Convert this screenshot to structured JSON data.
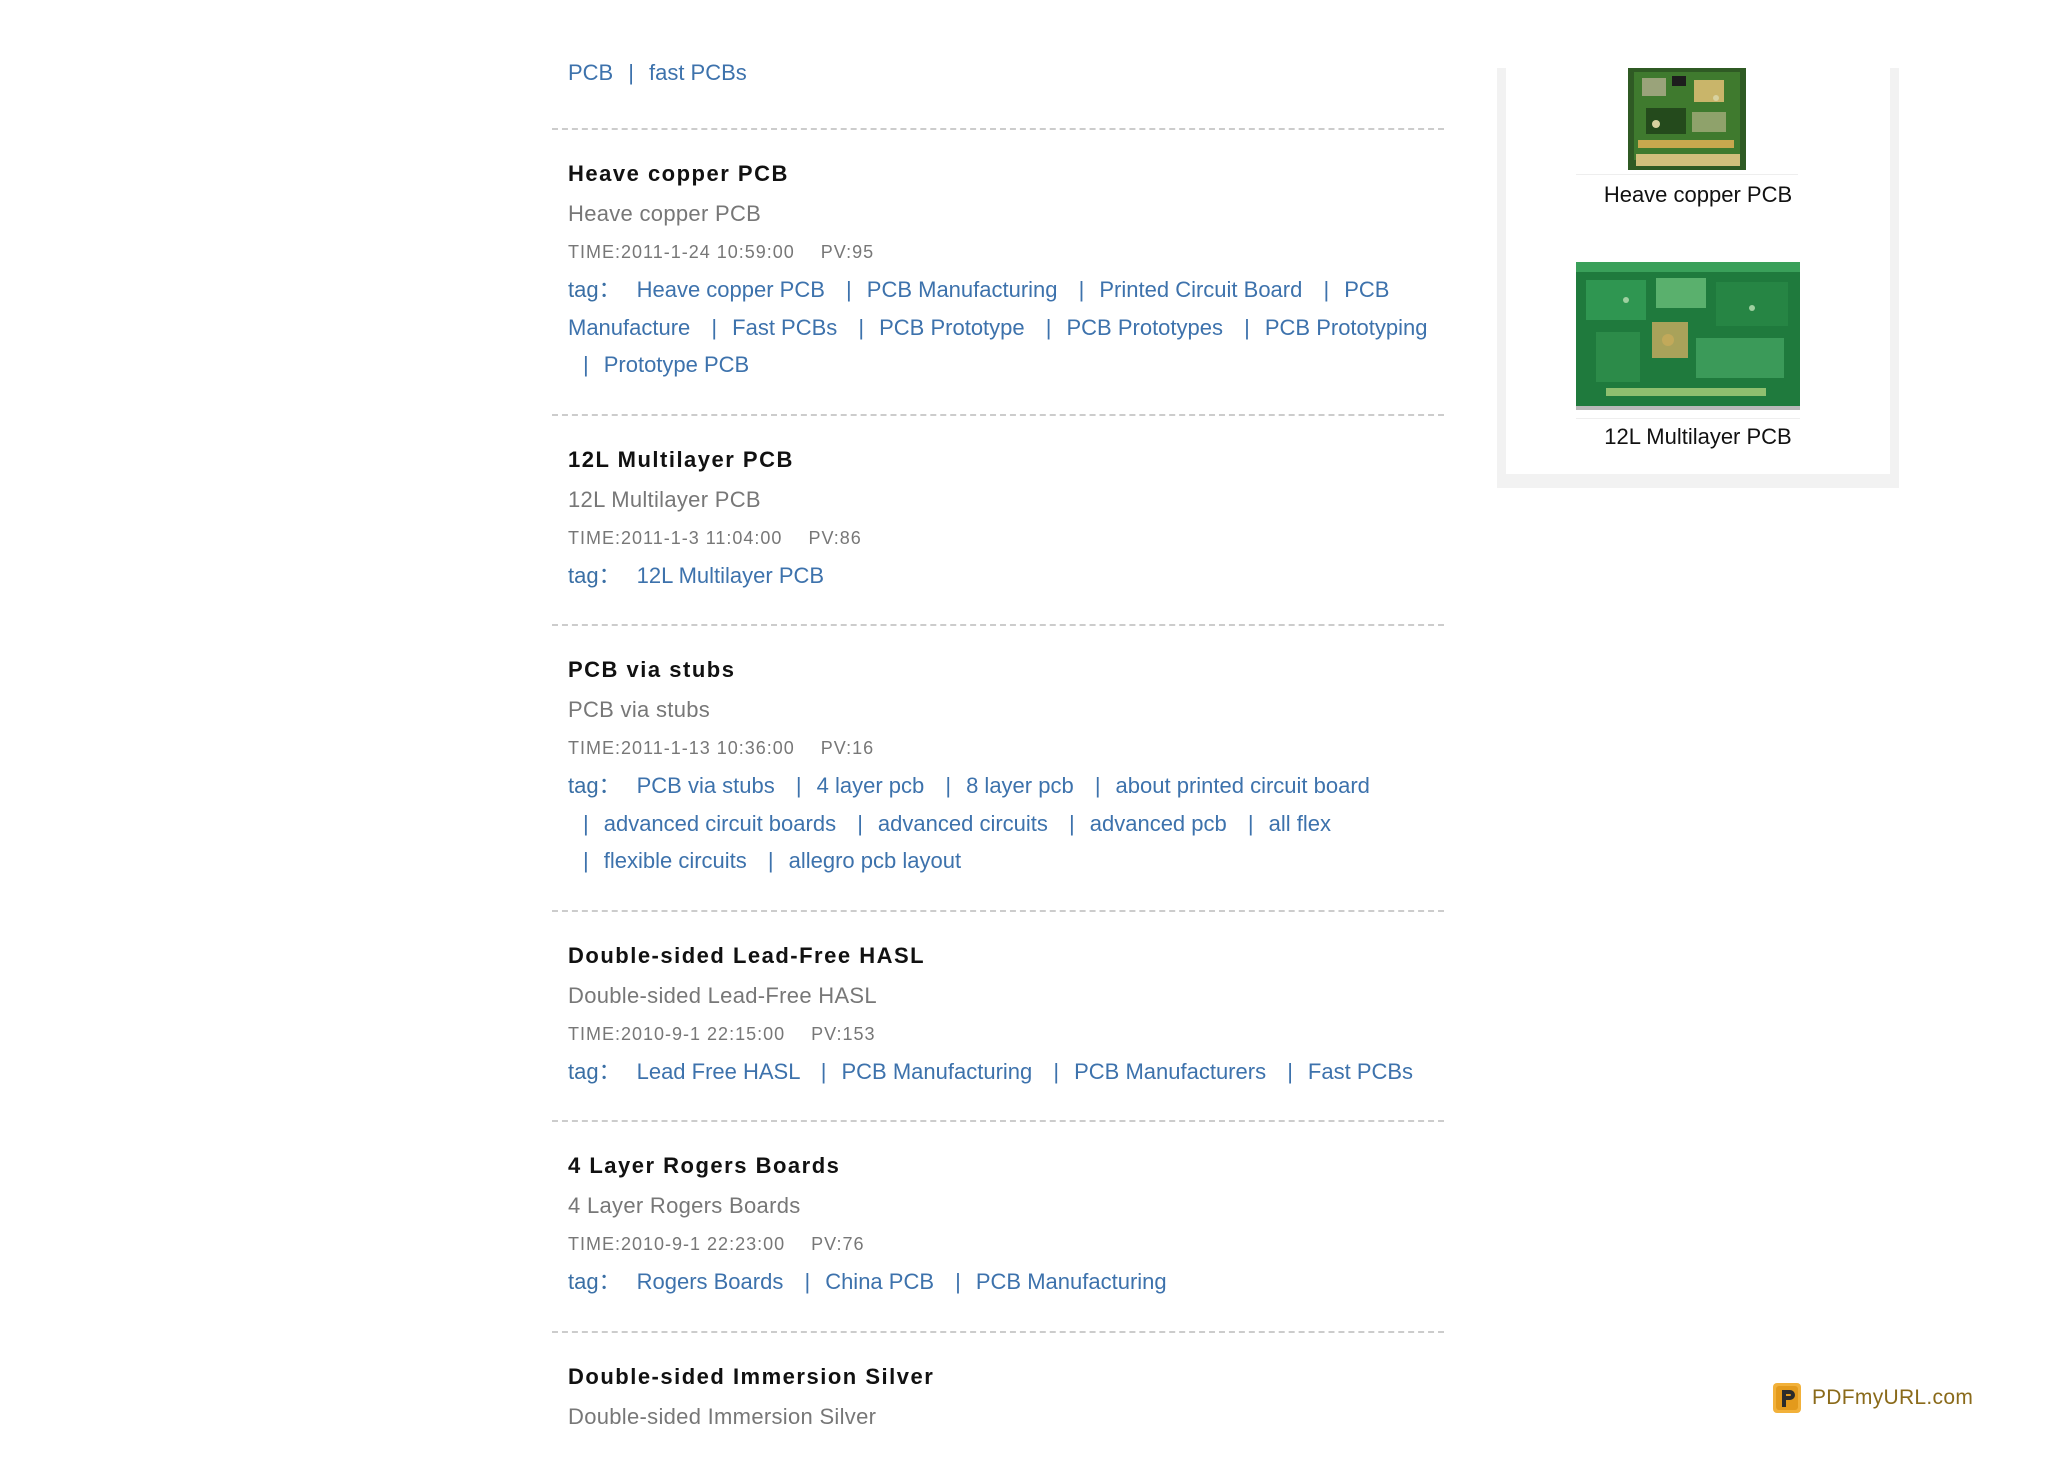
{
  "top_tags": [
    "PCB",
    "fast PCBs"
  ],
  "tag_label": "tag：",
  "articles": [
    {
      "title": "Heave copper PCB",
      "summary": "Heave copper PCB",
      "time": "TIME:2011-1-24 10:59:00",
      "pv": "PV:95",
      "tags": [
        "Heave copper PCB",
        "PCB Manufacturing",
        "Printed Circuit Board",
        "PCB Manufacture",
        "Fast PCBs",
        "PCB Prototype",
        "PCB Prototypes",
        "PCB Prototyping",
        "Prototype PCB"
      ]
    },
    {
      "title": "12L Multilayer PCB",
      "summary": "12L Multilayer PCB",
      "time": "TIME:2011-1-3 11:04:00",
      "pv": "PV:86",
      "tags": [
        "12L Multilayer PCB"
      ]
    },
    {
      "title": "PCB via stubs",
      "summary": "PCB via stubs",
      "time": "TIME:2011-1-13 10:36:00",
      "pv": "PV:16",
      "tags": [
        "PCB via stubs",
        "4 layer pcb",
        "8 layer pcb",
        "about printed circuit board",
        "advanced circuit boards",
        "advanced circuits",
        "advanced pcb",
        "all flex",
        "flexible circuits",
        "allegro pcb layout"
      ]
    },
    {
      "title": "Double-sided Lead-Free HASL",
      "summary": "Double-sided Lead-Free HASL",
      "time": "TIME:2010-9-1 22:15:00",
      "pv": "PV:153",
      "tags": [
        "Lead Free HASL",
        "PCB Manufacturing",
        "PCB Manufacturers",
        "Fast PCBs"
      ]
    },
    {
      "title": "4 Layer Rogers Boards",
      "summary": "4 Layer Rogers Boards",
      "time": "TIME:2010-9-1 22:23:00",
      "pv": "PV:76",
      "tags": [
        "Rogers Boards",
        "China PCB",
        "PCB Manufacturing"
      ]
    },
    {
      "title": "Double-sided Immersion Silver",
      "summary": "Double-sided Immersion Silver",
      "time": "",
      "pv": "",
      "tags": []
    }
  ],
  "sidebar": {
    "items": [
      {
        "caption": "Heave copper PCB",
        "image": "pcb-board-photo"
      },
      {
        "caption": "12L Multilayer PCB",
        "image": "pcb-board-photo"
      }
    ]
  },
  "footer": {
    "badge_text": "PDFmyURL.com",
    "badge_icon": "pdfmyurl-logo-icon"
  },
  "colors": {
    "link": "#3d72ac",
    "muted": "#777777",
    "title": "#111111",
    "badge": "#8a6a1a"
  }
}
